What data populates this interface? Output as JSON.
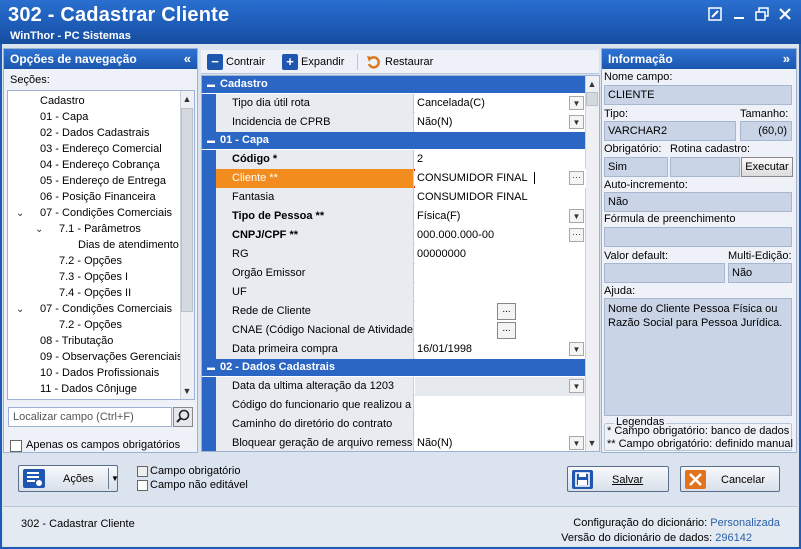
{
  "window": {
    "title": "302 - Cadastrar Cliente",
    "subtitle": "WinThor - PC Sistemas",
    "buttons": [
      "edit-icon",
      "minimize-icon",
      "restore-icon",
      "close-icon"
    ]
  },
  "nav": {
    "header": "Opções de navegação",
    "collapse_glyph": "«",
    "sections_label": "Seções:",
    "tree": [
      {
        "label": "Cadastro",
        "level": 0,
        "toggle": ""
      },
      {
        "label": "01 - Capa",
        "level": 0,
        "toggle": ""
      },
      {
        "label": "02 - Dados Cadastrais",
        "level": 0,
        "toggle": ""
      },
      {
        "label": "03 - Endereço Comercial",
        "level": 0,
        "toggle": ""
      },
      {
        "label": "04 - Endereço Cobrança",
        "level": 0,
        "toggle": ""
      },
      {
        "label": "05 - Endereço de Entrega",
        "level": 0,
        "toggle": ""
      },
      {
        "label": "06 - Posição Financeira",
        "level": 0,
        "toggle": ""
      },
      {
        "label": "07 - Condições Comerciais",
        "level": 0,
        "toggle": "v"
      },
      {
        "label": "7.1 - Parâmetros",
        "level": 1,
        "toggle": "v"
      },
      {
        "label": "Dias de atendimento",
        "level": 2,
        "toggle": ""
      },
      {
        "label": "7.2 - Opções",
        "level": 1,
        "toggle": ""
      },
      {
        "label": "7.3 - Opções I",
        "level": 1,
        "toggle": ""
      },
      {
        "label": "7.4 - Opções II",
        "level": 1,
        "toggle": ""
      },
      {
        "label": "07 - Condições Comerciais",
        "level": 0,
        "toggle": "v"
      },
      {
        "label": "7.2 - Opções",
        "level": 1,
        "toggle": ""
      },
      {
        "label": "08 - Tributação",
        "level": 0,
        "toggle": ""
      },
      {
        "label": "09 - Observações Gerenciais",
        "level": 0,
        "toggle": ""
      },
      {
        "label": "10 - Dados Profissionais",
        "level": 0,
        "toggle": ""
      },
      {
        "label": "11 - Dados Cônjuge",
        "level": 0,
        "toggle": ""
      }
    ],
    "search_placeholder": "Localizar campo (Ctrl+F)",
    "only_required_label": "Apenas os campos obrigatórios"
  },
  "toolbar": {
    "collapse_label": "Contrair",
    "expand_label": "Expandir",
    "restore_label": "Restaurar"
  },
  "grid": {
    "sections": [
      {
        "title": "Cadastro",
        "rows": [
          {
            "name": "Tipo dia útil rota",
            "value": "Cancelada(C)",
            "bold": false,
            "editor": "dropdown"
          },
          {
            "name": "Incidencia de CPRB",
            "value": "Não(N)",
            "bold": false,
            "editor": "dropdown"
          }
        ]
      },
      {
        "title": "01 - Capa",
        "rows": [
          {
            "name": "Código *",
            "value": "2",
            "bold": true,
            "editor": "none"
          },
          {
            "name": "Cliente **",
            "value": "CONSUMIDOR FINAL",
            "bold": false,
            "editor": "ellipsis",
            "selected": true
          },
          {
            "name": "Fantasia",
            "value": "CONSUMIDOR FINAL",
            "bold": false,
            "editor": "none"
          },
          {
            "name": "Tipo de Pessoa **",
            "value": "Física(F)",
            "bold": true,
            "editor": "dropdown"
          },
          {
            "name": "CNPJ/CPF **",
            "value": "000.000.000-00",
            "bold": true,
            "editor": "ellipsis"
          },
          {
            "name": "RG",
            "value": "00000000",
            "bold": false,
            "editor": "none"
          },
          {
            "name": "Orgão Emissor",
            "value": "",
            "bold": false,
            "editor": "none"
          },
          {
            "name": "UF",
            "value": "",
            "bold": false,
            "editor": "none"
          },
          {
            "name": "Rede de Cliente",
            "value": "",
            "bold": false,
            "editor": "button"
          },
          {
            "name": "CNAE (Código Nacional de Atividade E",
            "value": "",
            "bold": false,
            "editor": "button"
          },
          {
            "name": "Data primeira compra",
            "value": "16/01/1998",
            "bold": false,
            "editor": "dropdown"
          }
        ]
      },
      {
        "title": "02 - Dados Cadastrais",
        "rows": [
          {
            "name": "Data da ultima alteração da 1203",
            "value": "",
            "bold": false,
            "editor": "dropdown",
            "disabled": true
          },
          {
            "name": "Código do funcionario que realizou a (",
            "value": "",
            "bold": false,
            "editor": "none"
          },
          {
            "name": "Caminho do diretório do contrato",
            "value": "",
            "bold": false,
            "editor": "none"
          },
          {
            "name": "Bloquear geração de arquivo remessa",
            "value": "Não(N)",
            "bold": false,
            "editor": "dropdown"
          }
        ]
      }
    ]
  },
  "info": {
    "header": "Informação",
    "expand_glyph": "»",
    "field_name_label": "Nome campo:",
    "field_name": "CLIENTE",
    "type_label": "Tipo:",
    "type": "VARCHAR2",
    "size_label": "Tamanho:",
    "size": "(60,0)",
    "required_label": "Obrigatório:",
    "required": "Sim",
    "routine_label": "Rotina cadastro:",
    "execute_label": "Executar",
    "autoinc_label": "Auto-incremento:",
    "autoinc": "Não",
    "formula_label": "Fórmula de preenchimento",
    "formula": "",
    "default_label": "Valor default:",
    "default": "",
    "multiedit_label": "Multi-Edição:",
    "multiedit": "Não",
    "help_label": "Ajuda:",
    "help_text": "Nome do Cliente Pessoa Física ou Razão Social para Pessoa Jurídica.",
    "legend_title": "Legendas",
    "legend_1": "* Campo obrigatório: banco de dados",
    "legend_2": "** Campo obrigatório: definido manual"
  },
  "actions": {
    "acoes_label": "Ações",
    "legend_required": "Campo obrigatório",
    "legend_not_editable": "Campo não editável",
    "save_label": "Salvar",
    "cancel_label": "Cancelar"
  },
  "status": {
    "routine": "302 - Cadastrar Cliente",
    "dict_config_label": "Configuração do dicionário:",
    "dict_config_value": "Personalizada",
    "dict_version_label": "Versão do dicionário de dados:",
    "dict_version_value": "296142"
  },
  "colors": {
    "title_bar": "#1d5bb5",
    "section_header": "#2b66c4",
    "selected_row": "#f28c1e",
    "selected_border": "#e02020"
  }
}
